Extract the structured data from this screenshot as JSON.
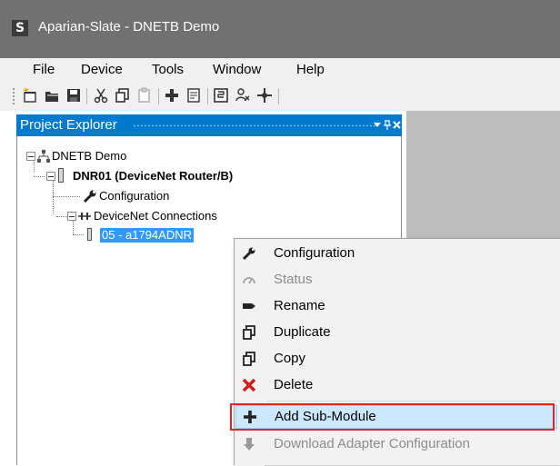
{
  "window": {
    "app_icon_glyph": "S",
    "title": "Aparian-Slate  - DNETB Demo"
  },
  "menu": {
    "items": [
      "File",
      "Device",
      "Tools",
      "Window",
      "Help"
    ]
  },
  "toolbar": {
    "buttons": [
      "new-project-icon",
      "open-icon",
      "save-icon",
      "cut-icon",
      "copy-icon",
      "paste-icon",
      "add-icon",
      "properties-icon",
      "module-icon",
      "users-icon",
      "network-icon"
    ]
  },
  "project_explorer": {
    "title": "Project Explorer",
    "controls": [
      "dropdown-icon",
      "pin-icon",
      "close-icon"
    ],
    "tree": {
      "root": "DNETB Demo",
      "device": "DNR01 (DeviceNet Router/B)",
      "configuration": "Configuration",
      "connections": "DeviceNet Connections",
      "selected_node": "05 - a1794ADNR"
    }
  },
  "context_menu": {
    "items": [
      {
        "label": "Configuration",
        "icon": "wrench-icon",
        "enabled": true
      },
      {
        "label": "Status",
        "icon": "gauge-icon",
        "enabled": false
      },
      {
        "label": "Rename",
        "icon": "rename-icon",
        "enabled": true
      },
      {
        "label": "Duplicate",
        "icon": "duplicate-icon",
        "enabled": true
      },
      {
        "label": "Copy",
        "icon": "copy-icon",
        "enabled": true
      },
      {
        "label": "Delete",
        "icon": "delete-x-icon",
        "enabled": true
      },
      {
        "label": "Add Sub-Module",
        "icon": "plus-icon",
        "enabled": true,
        "highlighted": true
      },
      {
        "label": "Download Adapter Configuration",
        "icon": "download-arrow-icon",
        "enabled": false
      }
    ]
  },
  "colors": {
    "titlebar": "#717171",
    "panel_header": "#007acc",
    "selection": "#3399ff",
    "highlight_box": "#e0222e",
    "workspace": "#bdbdbd"
  }
}
